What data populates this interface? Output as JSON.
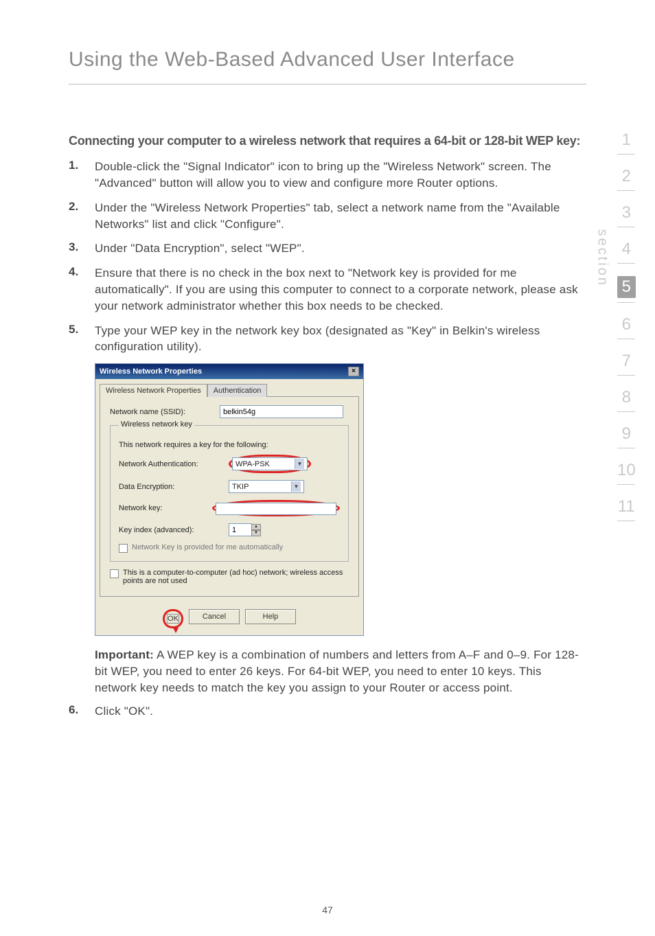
{
  "page": {
    "title": "Using the Web-Based Advanced User Interface",
    "number": "47"
  },
  "content": {
    "subtitle": "Connecting your computer to a wireless network that requires a 64-bit or 128-bit WEP key:",
    "steps": [
      {
        "num": "1.",
        "text": "Double-click the \"Signal Indicator\" icon to bring up the \"Wireless Network\" screen. The \"Advanced\" button will allow you to view and configure more Router options."
      },
      {
        "num": "2.",
        "text": "Under the \"Wireless Network Properties\" tab, select a network name from the \"Available Networks\" list and click \"Configure\"."
      },
      {
        "num": "3.",
        "text": "Under \"Data Encryption\", select \"WEP\"."
      },
      {
        "num": "4.",
        "text": "Ensure that there is no check in the box next to \"Network key is provided for me automatically\". If you are using this computer to connect to a corporate network, please ask your network administrator whether this box needs to be checked."
      },
      {
        "num": "5.",
        "text": "Type your WEP key in the network key box (designated as \"Key\" in Belkin's wireless configuration utility)."
      }
    ],
    "important_label": "Important:",
    "important_text": " A WEP key is a combination of numbers and letters from A–F and 0–9. For 128-bit WEP, you need to enter 26 keys. For 64-bit WEP, you need to enter 10 keys. This network key needs to match the key you assign to your Router or access point.",
    "step6": {
      "num": "6.",
      "text": "Click \"OK\"."
    }
  },
  "dialog": {
    "title": "Wireless Network Properties",
    "tabs": [
      "Wireless Network Properties",
      "Authentication"
    ],
    "network_name_label": "Network name (SSID):",
    "network_name_value": "belkin54g",
    "fieldset_legend": "Wireless network key",
    "fieldset_desc": "This network requires a key for the following:",
    "auth_label": "Network Authentication:",
    "auth_value": "WPA-PSK",
    "enc_label": "Data Encryption:",
    "enc_value": "TKIP",
    "key_label": "Network key:",
    "keyindex_label": "Key index (advanced):",
    "keyindex_value": "1",
    "auto_cb": "Network Key is provided for me automatically",
    "adhoc_cb": "This is a computer-to-computer (ad hoc) network; wireless access points are not used",
    "ok": "OK",
    "cancel": "Cancel",
    "help": "Help"
  },
  "sidebar": {
    "tabs": [
      "1",
      "2",
      "3",
      "4",
      "5",
      "6",
      "7",
      "8",
      "9",
      "10",
      "11"
    ],
    "active": "5",
    "label": "section"
  }
}
